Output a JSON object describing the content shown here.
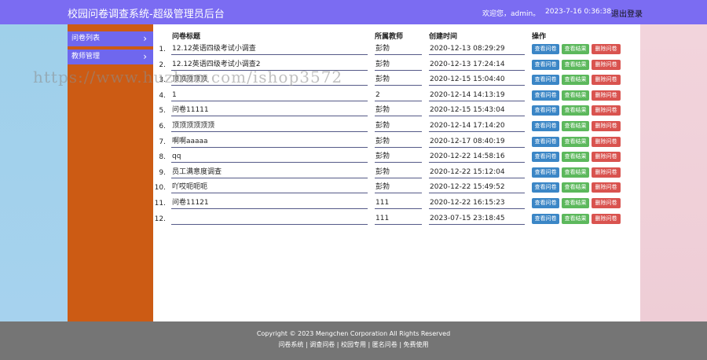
{
  "header": {
    "title": "校园问卷调查系统-超级管理员后台",
    "welcome": "欢迎您，admin。",
    "time": "2023-7-16 0:36:38",
    "logout_label": "退出登录"
  },
  "sidebar": {
    "items": [
      {
        "label": "问卷列表"
      },
      {
        "label": "教师管理"
      }
    ]
  },
  "table": {
    "headers": {
      "title": "问卷标题",
      "teacher": "所属教师",
      "created": "创建时间",
      "actions": "操作"
    },
    "buttons": {
      "view": "查看问卷",
      "result": "查看结果",
      "delete": "删除问卷"
    },
    "rows": [
      {
        "num": "1.",
        "title": "12.12英语四级考试小调查",
        "teacher": "彭勃",
        "created": "2020-12-13 08:29:29"
      },
      {
        "num": "2.",
        "title": "12.12英语四级考试小调查2",
        "teacher": "彭勃",
        "created": "2020-12-13 17:24:14"
      },
      {
        "num": "3.",
        "title": "顶顶顶顶顶",
        "teacher": "彭勃",
        "created": "2020-12-15 15:04:40"
      },
      {
        "num": "4.",
        "title": "1",
        "teacher": "2",
        "created": "2020-12-14 14:13:19"
      },
      {
        "num": "5.",
        "title": "问卷11111",
        "teacher": "彭勃",
        "created": "2020-12-15 15:43:04"
      },
      {
        "num": "6.",
        "title": "顶顶顶顶顶顶",
        "teacher": "彭勃",
        "created": "2020-12-14 17:14:20"
      },
      {
        "num": "7.",
        "title": "啊啊aaaaa",
        "teacher": "彭勃",
        "created": "2020-12-17 08:40:19"
      },
      {
        "num": "8.",
        "title": "qq",
        "teacher": "彭勃",
        "created": "2020-12-22 14:58:16"
      },
      {
        "num": "9.",
        "title": "员工满意度调查",
        "teacher": "彭勃",
        "created": "2020-12-22 15:12:04"
      },
      {
        "num": "10.",
        "title": "吖哎呃呃呃",
        "teacher": "彭勃",
        "created": "2020-12-22 15:49:52"
      },
      {
        "num": "11.",
        "title": "问卷11121",
        "teacher": "111",
        "created": "2020-12-22 16:15:23"
      },
      {
        "num": "12.",
        "title": "",
        "teacher": "111",
        "created": "2023-07-15 23:18:45"
      }
    ]
  },
  "footer": {
    "copyright": "Copyright © 2023 Mengchen Corporation All Rights Reserved",
    "links": "问卷系统 | 调查问卷 | 校园专用 | 匿名问卷 | 免费使用"
  },
  "watermark": "https://www.huzhan.com/ishop3572"
}
